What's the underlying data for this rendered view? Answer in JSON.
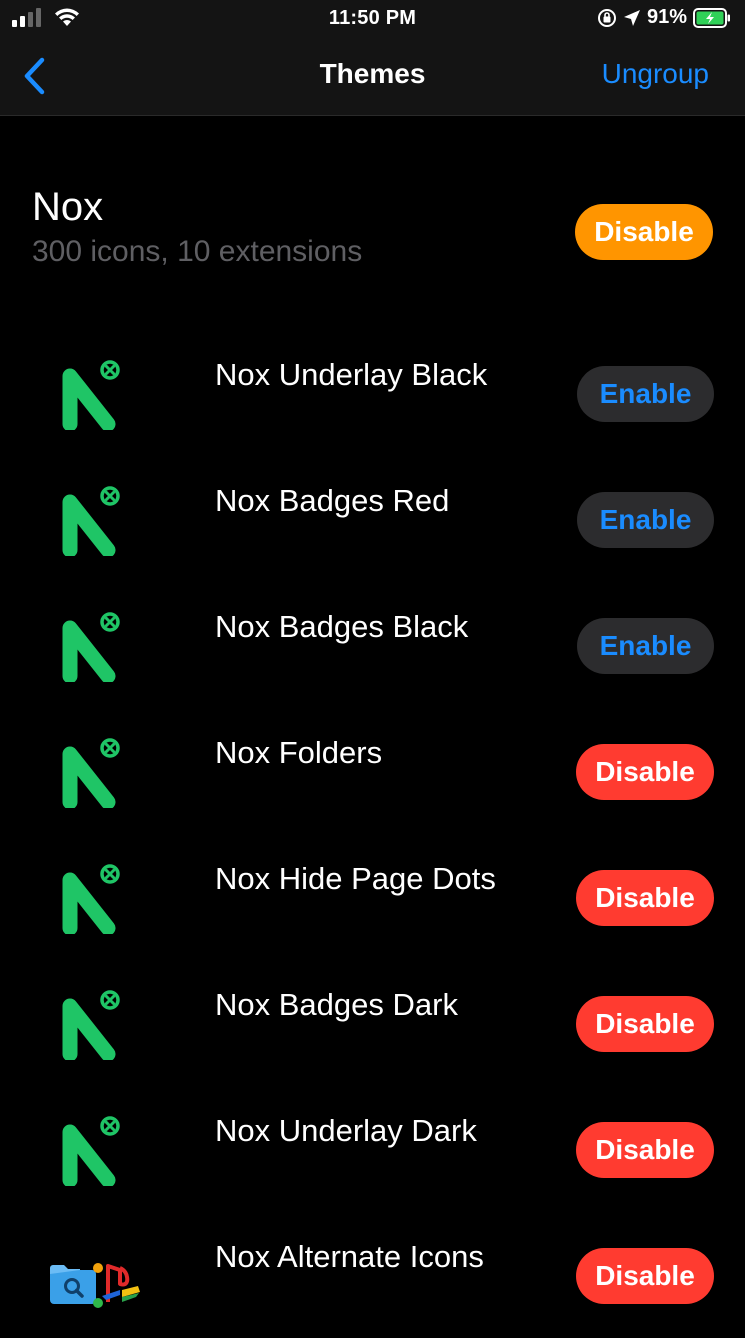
{
  "status_bar": {
    "time": "11:50 PM",
    "battery": "91%",
    "icons": [
      "signal-icon",
      "wifi-icon",
      "orientation-lock-icon",
      "location-icon",
      "battery-icon"
    ]
  },
  "navbar": {
    "title": "Themes",
    "back_icon": "chevron-left-icon",
    "ungroup_label": "Ungroup"
  },
  "group": {
    "title": "Nox",
    "subtitle": "300 icons, 10 extensions",
    "action_label": "Disable"
  },
  "items": [
    {
      "label": "Nox Underlay Black",
      "action": "Enable",
      "state": "disabled",
      "icon": "nox-icon"
    },
    {
      "label": "Nox Badges Red",
      "action": "Enable",
      "state": "disabled",
      "icon": "nox-icon"
    },
    {
      "label": "Nox Badges Black",
      "action": "Enable",
      "state": "disabled",
      "icon": "nox-icon"
    },
    {
      "label": "Nox Folders",
      "action": "Disable",
      "state": "enabled",
      "icon": "nox-icon"
    },
    {
      "label": "Nox Hide Page Dots",
      "action": "Disable",
      "state": "enabled",
      "icon": "nox-icon"
    },
    {
      "label": "Nox Badges Dark",
      "action": "Disable",
      "state": "enabled",
      "icon": "nox-icon"
    },
    {
      "label": "Nox Underlay Dark",
      "action": "Disable",
      "state": "enabled",
      "icon": "nox-icon"
    },
    {
      "label": "Nox Alternate Icons",
      "action": "Disable",
      "state": "enabled",
      "icon": "alternate-icons-preview-icon"
    }
  ],
  "colors": {
    "accent_blue": "#1a8cff",
    "disable_red": "#ff3b30",
    "disable_orange": "#ff9500",
    "enable_bg": "#2c2c2e",
    "nox_green": "#1fc566"
  }
}
